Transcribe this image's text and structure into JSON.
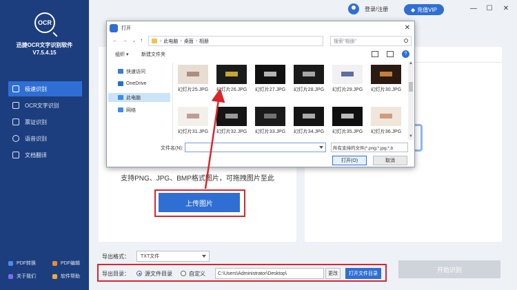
{
  "app": {
    "logo_text": "OCR",
    "name": "迅捷OCR文字识别软件",
    "version": "V7.5.4.15"
  },
  "sidebar": {
    "items": [
      {
        "label": "极速识别",
        "icon": "lightning-icon"
      },
      {
        "label": "OCR文字识别",
        "icon": "scan-icon"
      },
      {
        "label": "票证识别",
        "icon": "ticket-icon"
      },
      {
        "label": "语音识别",
        "icon": "microphone-icon"
      },
      {
        "label": "文档翻译",
        "icon": "translate-icon"
      }
    ],
    "bottom_links": [
      {
        "label": "PDF转换"
      },
      {
        "label": "PDF编辑"
      },
      {
        "label": "关于我们"
      },
      {
        "label": "软件帮助"
      }
    ]
  },
  "topbar": {
    "login_label": "登录/注册",
    "vip_label": "充值VIP",
    "minimize": "—",
    "maximize": "☐",
    "close": "✕"
  },
  "main": {
    "support_text": "支持PNG、JPG、BMP格式图片，可拖拽图片至此",
    "upload_label": "上传图片",
    "export_format_label": "导出格式：",
    "export_format_value": "TXT文件",
    "export_dir_label": "导出目录：",
    "radio_source": "源文件目录",
    "radio_custom": "自定义",
    "path_value": "C:\\Users\\Administrator\\Desktop\\",
    "change_label": "更改",
    "open_dir_label": "打开文件目录",
    "start_label": "开始识别"
  },
  "dialog": {
    "title": "打开",
    "close": "✕",
    "breadcrumb": [
      "此电脑",
      "桌面",
      "相册"
    ],
    "search_placeholder": "搜索\"相册\"",
    "organize_label": "组织 ▾",
    "new_folder_label": "新建文件夹",
    "nav_items": [
      {
        "label": "快速访问",
        "icon": "star-icon",
        "color": "#3a7bd5"
      },
      {
        "label": "OneDrive",
        "icon": "cloud-icon",
        "color": "#1e73c8"
      },
      {
        "label": "此电脑",
        "icon": "computer-icon",
        "color": "#3a8ee6"
      },
      {
        "label": "网络",
        "icon": "network-icon",
        "color": "#3a8ee6"
      }
    ],
    "files": [
      {
        "name": "幻灯片25.JPG",
        "bg": "#e8ddd3",
        "accent": "#9c7b6a"
      },
      {
        "name": "幻灯片26.JPG",
        "bg": "#1b1b1b",
        "accent": "#f0c93a"
      },
      {
        "name": "幻灯片27.JPG",
        "bg": "#111111",
        "accent": "#dddddd"
      },
      {
        "name": "幻灯片28.JPG",
        "bg": "#1a1a1a",
        "accent": "#c9c9c9"
      },
      {
        "name": "幻灯片29.JPG",
        "bg": "#f1f1f3",
        "accent": "#3b4d8a"
      },
      {
        "name": "幻灯片30.JPG",
        "bg": "#2a1a12",
        "accent": "#e89a45"
      },
      {
        "name": "幻灯片31.JPG",
        "bg": "#f3f0ec",
        "accent": "#b08b80"
      },
      {
        "name": "幻灯片32.JPG",
        "bg": "#151515",
        "accent": "#bbbbbb"
      },
      {
        "name": "幻灯片33.JPG",
        "bg": "#1a1a1a",
        "accent": "#888888"
      },
      {
        "name": "幻灯片34.JPG",
        "bg": "#141414",
        "accent": "#d0d0d0"
      },
      {
        "name": "幻灯片35.JPG",
        "bg": "#0f0f0f",
        "accent": "#e6e6e6"
      },
      {
        "name": "幻灯片36.JPG",
        "bg": "#f0e6dc",
        "accent": "#c58a6a"
      }
    ],
    "filename_label": "文件名(N):",
    "filetype_value": "所有支持的文件(*.png;*.jpg;*.b",
    "open_label": "打开(O)",
    "cancel_label": "取消"
  }
}
